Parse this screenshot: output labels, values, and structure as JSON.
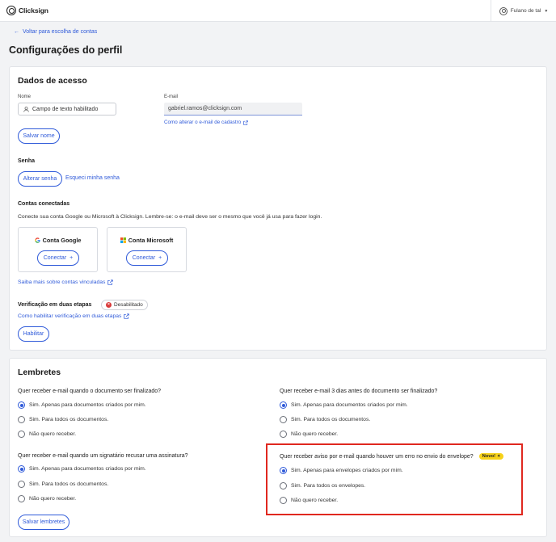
{
  "header": {
    "logo_text": "Clicksign",
    "user_name": "Fulano de tal"
  },
  "nav": {
    "back_link": "Voltar para escolha de contas"
  },
  "page": {
    "title": "Configurações do perfil"
  },
  "access": {
    "section_title": "Dados de acesso",
    "name_label": "Nome",
    "name_value": "Campo de texto habilitado",
    "email_label": "E-mail",
    "email_value": "gabriel.ramos@clicksign.com",
    "email_change_link": "Como alterar o e-mail de cadastro",
    "save_name_button": "Salvar nome",
    "password_title": "Senha",
    "change_password_button": "Alterar senha",
    "forgot_password_link": "Esqueci minha senha",
    "connected_title": "Contas conectadas",
    "connected_text": "Conecte sua conta Google ou Microsoft à Clicksign. Lembre-se: o e-mail deve ser o mesmo que você já usa para fazer login.",
    "google_title": "Conta Google",
    "microsoft_title": "Conta Microsoft",
    "connect_label": "Conectar",
    "linked_accounts_link": "Saiba mais sobre contas vinculadas",
    "two_step_title": "Verificação em duas etapas",
    "two_step_status": "Desabilitado",
    "two_step_link": "Como habilitar verificação em duas etapas",
    "enable_button": "Habilitar"
  },
  "reminders": {
    "section_title": "Lembretes",
    "q1": {
      "question": "Quer receber e-mail quando o  documento ser finalizado?",
      "options": [
        "Sim. Apenas para documentos criados por mim.",
        "Sim. Para todos os documentos.",
        "Não quero receber."
      ],
      "selected": 0
    },
    "q2": {
      "question": "Quer receber e-mail 3 dias antes do documento ser finalizado?",
      "options": [
        "Sim. Apenas para documentos criados por mim.",
        "Sim. Para todos os documentos.",
        "Não quero receber."
      ],
      "selected": 0
    },
    "q3": {
      "question": "Quer receber e-mail quando um signatário recusar uma assinatura?",
      "options": [
        "Sim. Apenas para documentos criados por mim.",
        "Sim. Para todos os documentos.",
        "Não quero receber."
      ],
      "selected": 0
    },
    "q4": {
      "question": "Quer receber aviso por e-mail quando houver um erro no envio do envelope?",
      "badge": "Novo!",
      "options": [
        "Sim. Apenas para envelopes criados por mim.",
        "Sim. Para todos os envelopes.",
        "Não quero receber."
      ],
      "selected": 0
    },
    "save_button": "Salvar lembretes"
  },
  "colors": {
    "accent": "#2f5ad9",
    "highlight": "#e0281f",
    "badge_new": "#f7d21a",
    "status_disabled": "#d93a3a"
  }
}
